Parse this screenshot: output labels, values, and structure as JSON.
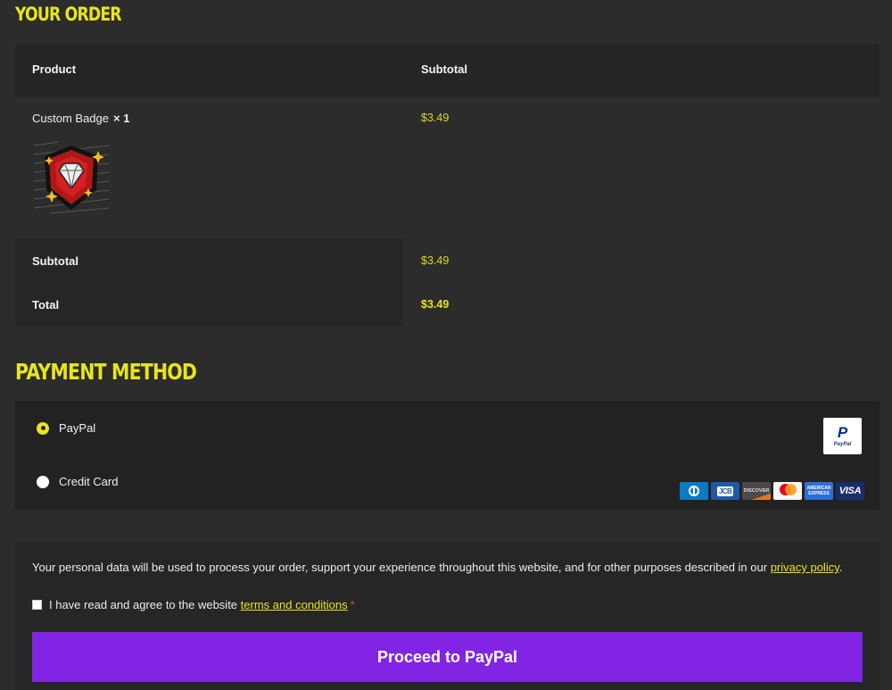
{
  "order": {
    "heading": "YOUR ORDER",
    "columns": {
      "product": "Product",
      "subtotal": "Subtotal"
    },
    "items": [
      {
        "name": "Custom Badge",
        "qty": "× 1",
        "subtotal": "$3.49",
        "image": "badge-red-shield-diamond"
      }
    ],
    "subtotal_label": "Subtotal",
    "subtotal_value": "$3.49",
    "total_label": "Total",
    "total_value": "$3.49"
  },
  "payment": {
    "heading": "PAYMENT METHOD",
    "options": [
      {
        "label": "PayPal",
        "selected": true,
        "logo": "paypal-logo"
      },
      {
        "label": "Credit Card",
        "selected": false,
        "logos": [
          "diners-club",
          "jcb",
          "discover",
          "mastercard",
          "american-express",
          "visa"
        ]
      }
    ],
    "paypal_logo_text": "PayPal",
    "card_labels": {
      "jcb": "JCB",
      "discover": "DISCOVER",
      "amex": "AMERICAN EXPRESS",
      "visa": "VISA"
    }
  },
  "terms": {
    "privacy_text": "Your personal data will be used to process your order, support your experience throughout this website, and for other purposes described in our ",
    "privacy_link": "privacy policy",
    "privacy_end": ".",
    "agree_text": "I have read and agree to the website ",
    "terms_link": "terms and conditions",
    "required_mark": "*",
    "agree_checked": false
  },
  "actions": {
    "proceed_label": "Proceed to PayPal"
  },
  "colors": {
    "accent": "#e8e51a",
    "button": "#8224e3",
    "background": "#2c2c2c"
  }
}
